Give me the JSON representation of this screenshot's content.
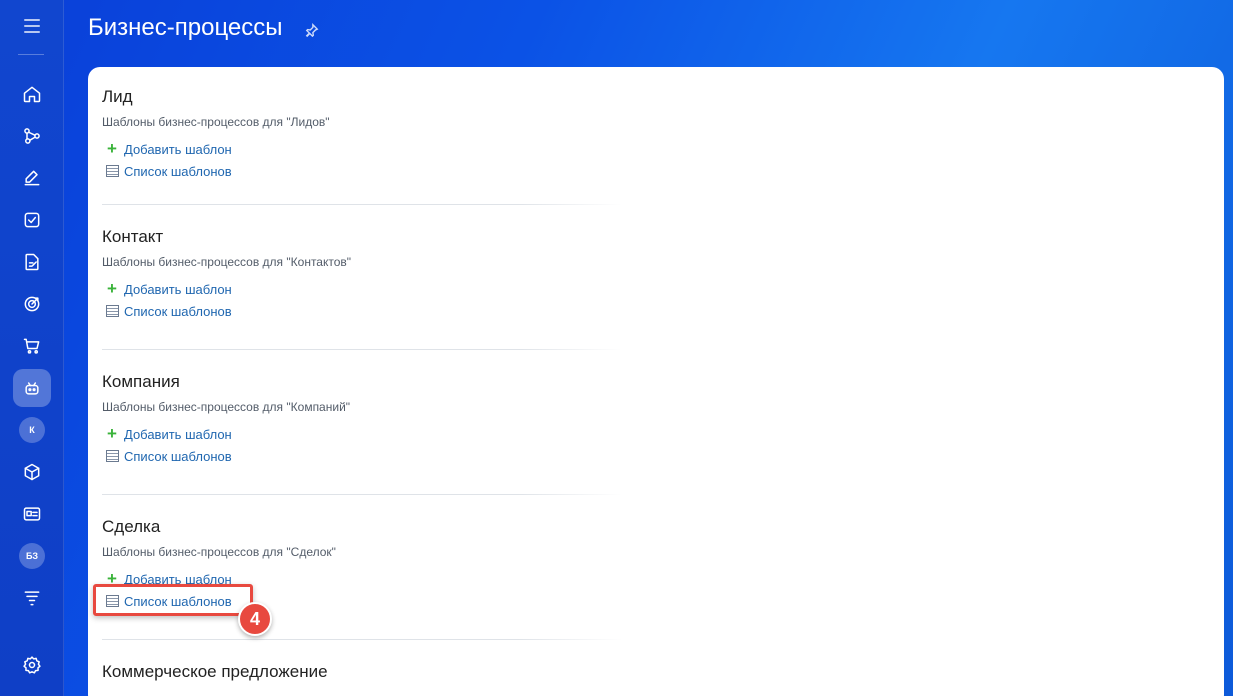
{
  "page": {
    "title": "Бизнес-процессы"
  },
  "sidebar": {
    "badges": {
      "k": "К",
      "bz": "БЗ"
    }
  },
  "sections": [
    {
      "title": "Лид",
      "desc": "Шаблоны бизнес-процессов для \"Лидов\"",
      "add": "Добавить шаблон",
      "list": "Список шаблонов"
    },
    {
      "title": "Контакт",
      "desc": "Шаблоны бизнес-процессов для \"Контактов\"",
      "add": "Добавить шаблон",
      "list": "Список шаблонов"
    },
    {
      "title": "Компания",
      "desc": "Шаблоны бизнес-процессов для \"Компаний\"",
      "add": "Добавить шаблон",
      "list": "Список шаблонов"
    },
    {
      "title": "Сделка",
      "desc": "Шаблоны бизнес-процессов для \"Сделок\"",
      "add": "Добавить шаблон",
      "list": "Список шаблонов"
    },
    {
      "title": "Коммерческое предложение"
    }
  ],
  "annotation": {
    "step": "4",
    "color": "#e8493f"
  }
}
